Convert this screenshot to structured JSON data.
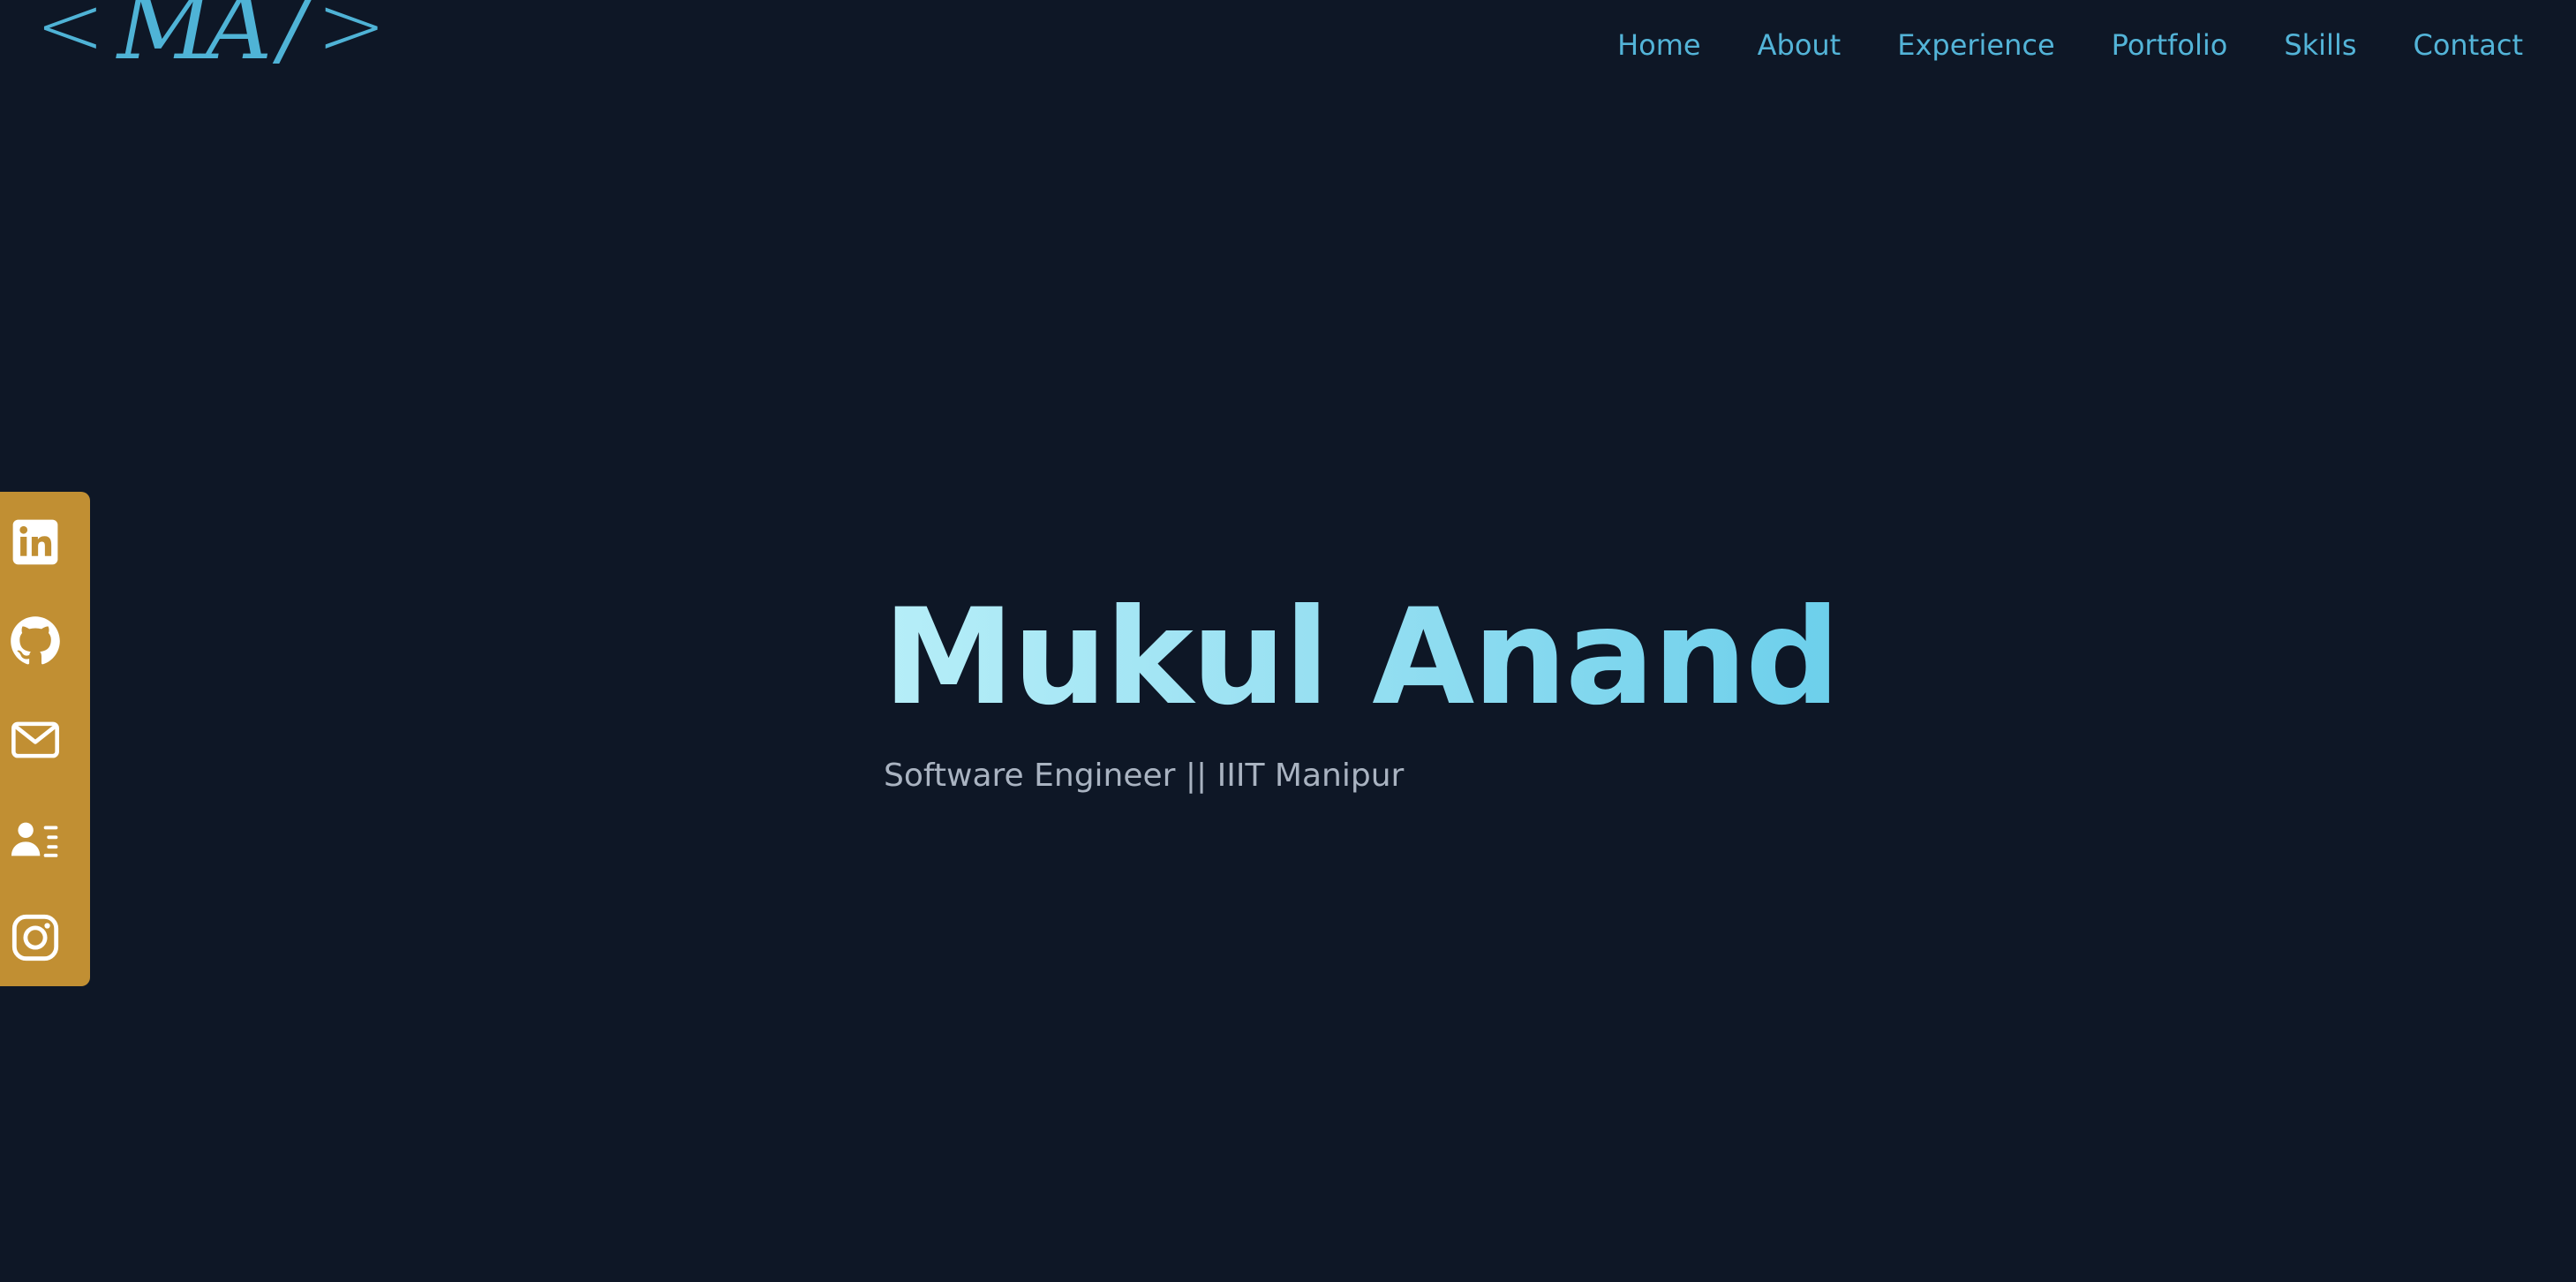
{
  "logo": {
    "open_bracket": "<",
    "initials": "MA",
    "slash": "/",
    "close_bracket": ">"
  },
  "nav": {
    "items": [
      {
        "label": "Home"
      },
      {
        "label": "About"
      },
      {
        "label": "Experience"
      },
      {
        "label": "Portfolio"
      },
      {
        "label": "Skills"
      },
      {
        "label": "Contact"
      }
    ]
  },
  "social": {
    "icons": [
      "linkedin-icon",
      "github-icon",
      "mail-icon",
      "resume-icon",
      "instagram-icon"
    ]
  },
  "hero": {
    "name": "Mukul Anand",
    "subtitle": "Software Engineer || IIIT Manipur"
  },
  "colors": {
    "background": "#0e1726",
    "accent": "#53b4d8",
    "sidebar": "#c18f33",
    "subtitle": "#a9b3c1"
  }
}
